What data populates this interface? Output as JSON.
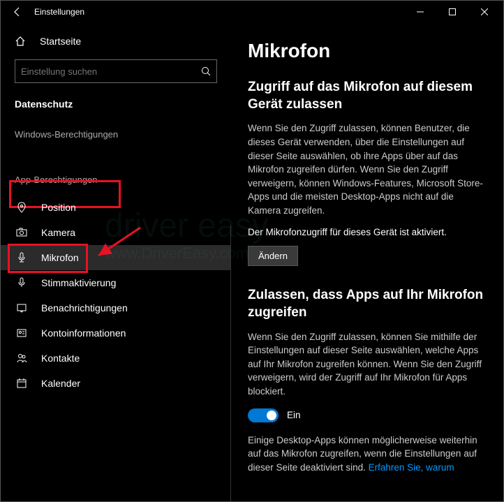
{
  "titlebar": {
    "title": "Einstellungen"
  },
  "sidebar": {
    "home": "Startseite",
    "search_placeholder": "Einstellung suchen",
    "section": "Datenschutz",
    "group_windows": "Windows-Berechtigungen",
    "group_apps": "App-Berechtigungen",
    "items": {
      "position": "Position",
      "camera": "Kamera",
      "microphone": "Mikrofon",
      "voice": "Stimmaktivierung",
      "notifications": "Benachrichtigungen",
      "account": "Kontoinformationen",
      "contacts": "Kontakte",
      "calendar": "Kalender"
    }
  },
  "main": {
    "heading": "Mikrofon",
    "s1_title": "Zugriff auf das Mikrofon auf diesem Gerät zulassen",
    "s1_body": "Wenn Sie den Zugriff zulassen, können Benutzer, die dieses Gerät verwenden, über die Einstellungen auf dieser Seite auswählen, ob ihre Apps über auf das Mikrofon zugreifen dürfen. Wenn Sie den Zugriff verweigern, können Windows-Features, Microsoft Store-Apps und die meisten Desktop-Apps nicht auf die Kamera zugreifen.",
    "s1_status": "Der Mikrofonzugriff für dieses Gerät ist aktiviert.",
    "s1_button": "Ändern",
    "s2_title": "Zulassen, dass Apps auf Ihr Mikrofon zugreifen",
    "s2_body": "Wenn Sie den Zugriff zulassen, können Sie mithilfe der Einstellungen auf dieser Seite auswählen, welche Apps auf Ihr Mikrofon zugreifen können. Wenn Sie den Zugriff verweigern, wird der Zugriff auf Ihr Mikrofon für Apps blockiert.",
    "toggle_label": "Ein",
    "s3_body": "Einige Desktop-Apps können möglicherweise weiterhin auf das Mikrofon zugreifen, wenn die Einstellungen auf dieser Seite deaktiviert sind. ",
    "s3_link": "Erfahren Sie, warum"
  },
  "watermark": {
    "line1": "driver easy",
    "line2": "www.DriverEasy.com"
  }
}
